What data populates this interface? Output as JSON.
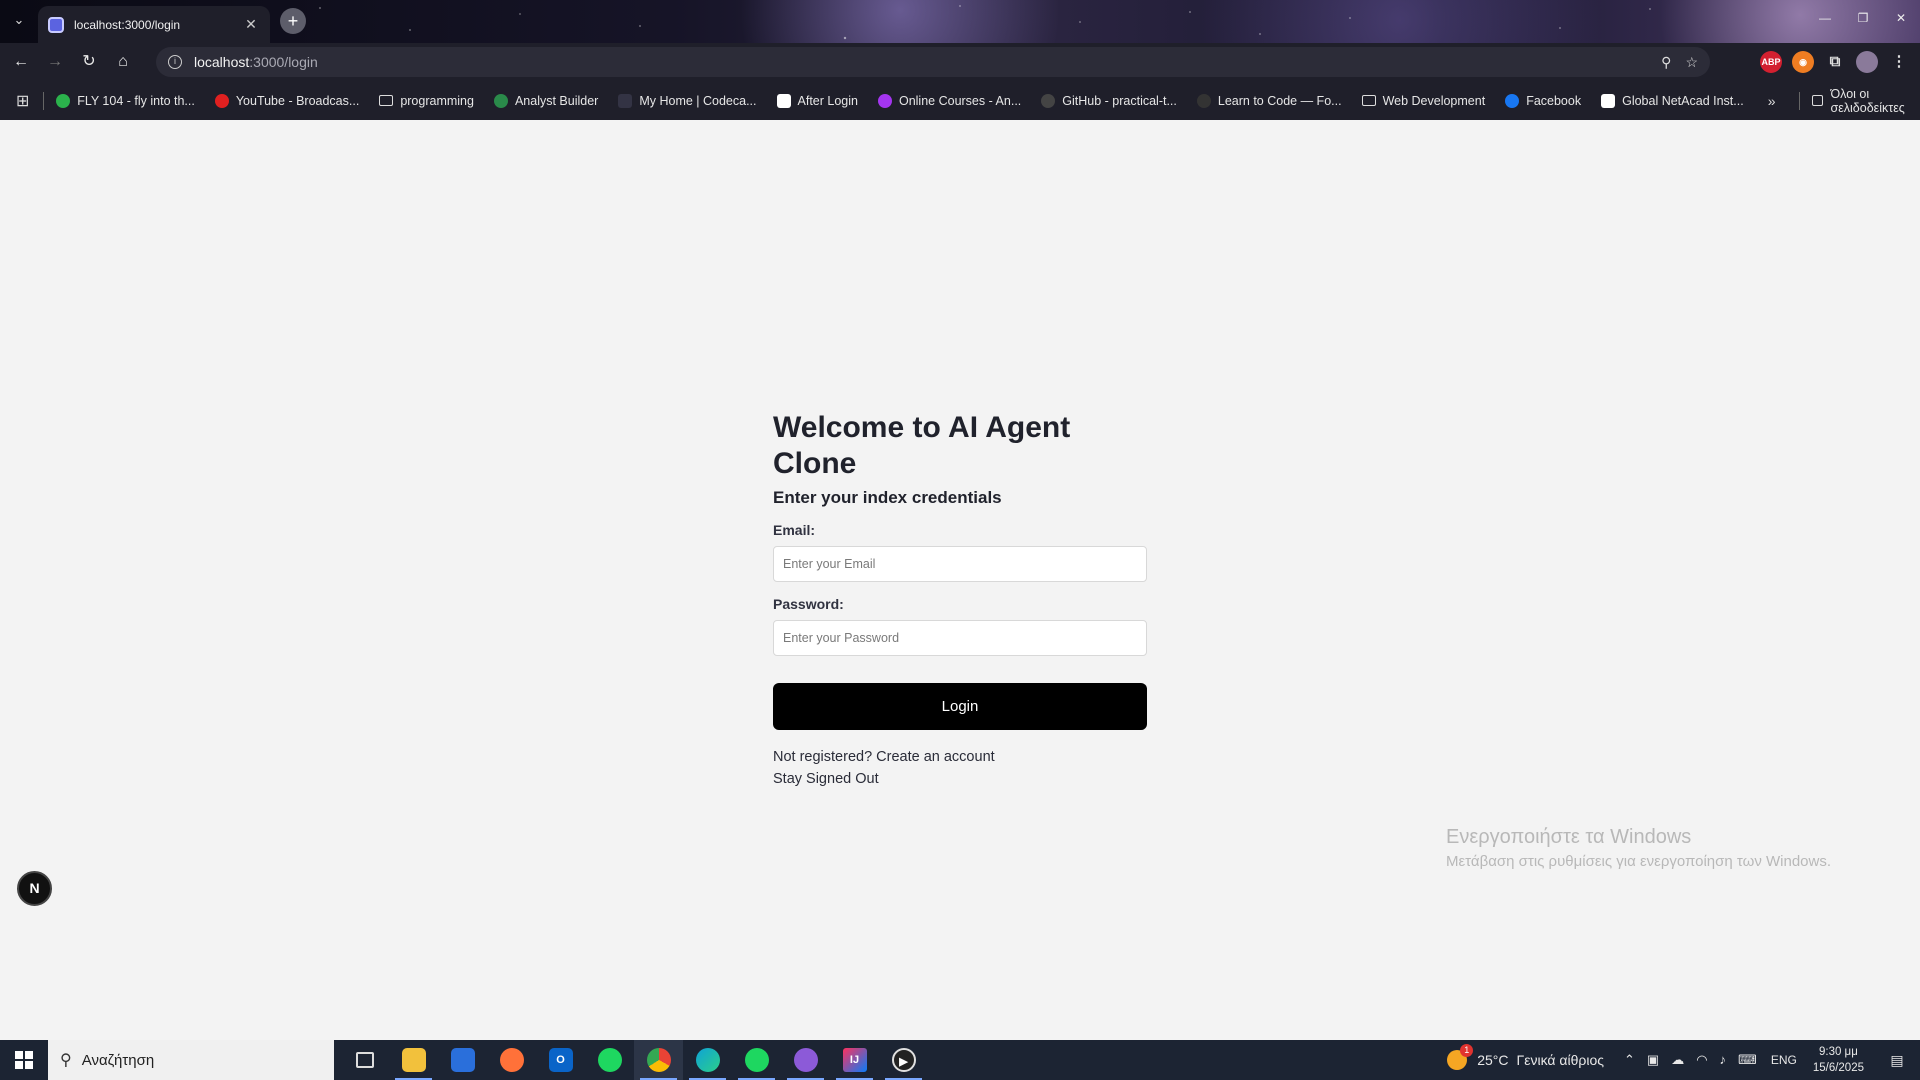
{
  "browser": {
    "tab": {
      "title": "localhost:3000/login",
      "close_glyph": "✕"
    },
    "new_tab_glyph": "+",
    "url": {
      "host": "localhost",
      "path": ":3000/login"
    },
    "bookmarks": [
      {
        "label": "FLY 104 - fly into th...",
        "icon": "play-icon",
        "color": "#2bb24c"
      },
      {
        "label": "YouTube - Broadcas...",
        "icon": "youtube-icon",
        "color": "#e02020"
      },
      {
        "label": "programming",
        "icon": "folder-icon",
        "color": ""
      },
      {
        "label": "Analyst Builder",
        "icon": "analyst-builder-icon",
        "color": "#2a8a4a"
      },
      {
        "label": "My Home | Codeca...",
        "icon": "codecademy-icon",
        "color": "#333344"
      },
      {
        "label": "After Login",
        "icon": "page-icon",
        "color": "#ffffff"
      },
      {
        "label": "Online Courses - An...",
        "icon": "udemy-icon",
        "color": "#a435f0"
      },
      {
        "label": "GitHub - practical-t...",
        "icon": "github-icon",
        "color": "#444"
      },
      {
        "label": "Learn to Code — Fo...",
        "icon": "freecodecamp-icon",
        "color": "#333"
      },
      {
        "label": "Web Development",
        "icon": "folder-icon",
        "color": ""
      },
      {
        "label": "Facebook",
        "icon": "facebook-icon",
        "color": "#1877f2"
      },
      {
        "label": "Global NetAcad Inst...",
        "icon": "netacad-icon",
        "color": "#ffffff"
      }
    ],
    "all_bookmarks": "Όλοι οι σελιδοδείκτες"
  },
  "page": {
    "title": "Welcome to AI Agent Clone",
    "subtitle": "Enter your index credentials",
    "email": {
      "label": "Email:",
      "placeholder": "Enter your Email",
      "value": ""
    },
    "password": {
      "label": "Password:",
      "placeholder": "Enter your Password",
      "value": ""
    },
    "login_button": "Login",
    "register_link": "Not registered? Create an account",
    "stay_signed_out_link": "Stay Signed Out"
  },
  "dev_badge": "N",
  "watermark": {
    "title": "Ενεργοποιήστε τα Windows",
    "subtitle": "Μετάβαση στις ρυθμίσεις για ενεργοποίηση των Windows."
  },
  "taskbar": {
    "search_placeholder": "Αναζήτηση",
    "weather": {
      "temp": "25°C",
      "desc": "Γενικά αίθριος",
      "badge": "1"
    },
    "language": "ENG",
    "time": "9:30 μμ",
    "date": "15/6/2025"
  }
}
